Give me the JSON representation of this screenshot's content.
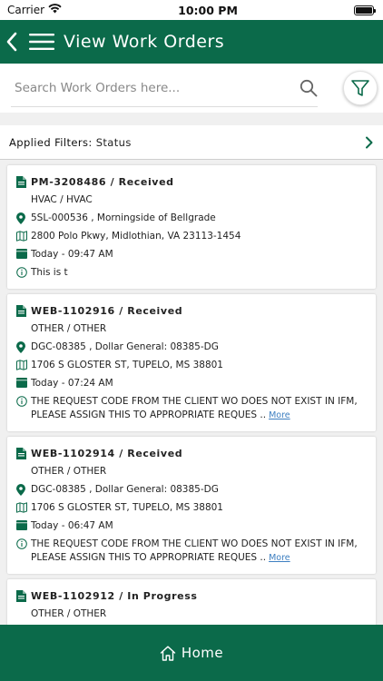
{
  "status_bar": {
    "carrier": "Carrier",
    "time": "10:00 PM"
  },
  "header": {
    "title": "View Work Orders"
  },
  "search": {
    "placeholder": "Search Work Orders here..."
  },
  "applied_filters": {
    "label": "Applied Filters:",
    "value": "Status"
  },
  "work_orders": [
    {
      "title": "PM-3208486 / Received",
      "category": "HVAC / HVAC",
      "location": "5SL-000536 , Morningside of Bellgrade",
      "address": "2800 Polo Pkwy, Midlothian, VA 23113-1454",
      "date": "Today - 09:47 AM",
      "note_line1": "This is t"
    },
    {
      "title": "WEB-1102916 / Received",
      "category": "OTHER / OTHER",
      "location": "DGC-08385 , Dollar General: 08385-DG",
      "address": "1706 S GLOSTER ST, TUPELO, MS 38801",
      "date": "Today - 07:24 AM",
      "note_line1": "THE REQUEST CODE FROM THE CLIENT WO DOES NOT EXIST IN IFM,",
      "note_line2": "PLEASE ASSIGN THIS TO APPROPRIATE REQUES ..",
      "more": "More"
    },
    {
      "title": "WEB-1102914 / Received",
      "category": "OTHER / OTHER",
      "location": "DGC-08385 , Dollar General: 08385-DG",
      "address": "1706 S GLOSTER ST, TUPELO, MS 38801",
      "date": "Today - 06:47 AM",
      "note_line1": "THE REQUEST CODE FROM THE CLIENT WO DOES NOT EXIST IN IFM,",
      "note_line2": "PLEASE ASSIGN THIS TO APPROPRIATE REQUES ..",
      "more": "More"
    },
    {
      "title": "WEB-1102912 / In Progress",
      "category": "OTHER / OTHER"
    }
  ],
  "bottom_nav": {
    "home_label": "Home"
  },
  "colors": {
    "brand_green": "#0b6a4a",
    "link_blue": "#3d7fc1"
  }
}
